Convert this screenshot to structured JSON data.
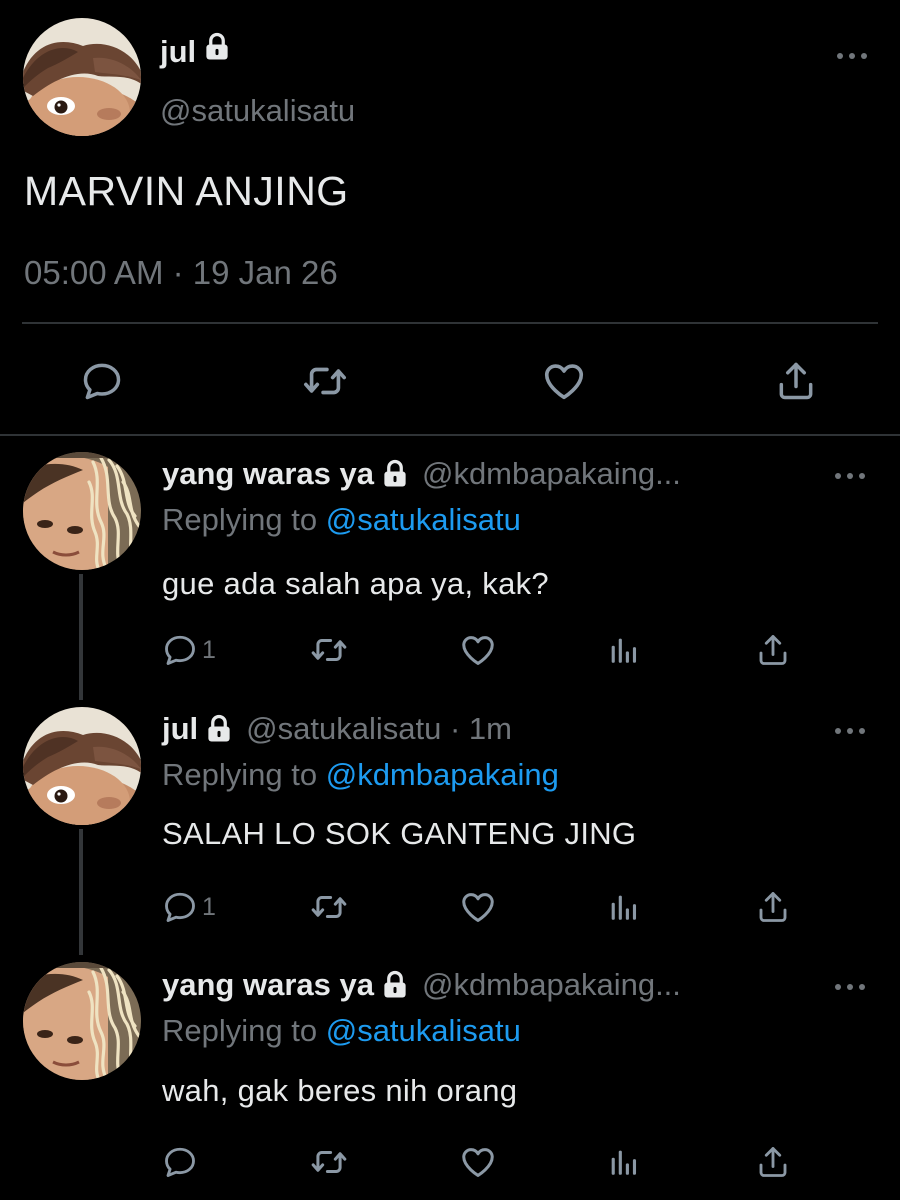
{
  "tweet": {
    "name": "jul",
    "handle": "@satukalisatu",
    "text": "MARVIN ANJING",
    "timestamp": "05:00 AM · 19 Jan 26"
  },
  "replies": [
    {
      "name": "yang waras ya",
      "handle": "@kdmbapakaing...",
      "replying_label": "Replying to ",
      "replying_to": "@satukalisatu",
      "text": "gue ada salah apa ya, kak?",
      "reply_count": "1"
    },
    {
      "name": "jul",
      "handle": "@satukalisatu · 1m",
      "replying_label": "Replying to ",
      "replying_to": "@kdmbapakaing",
      "text": "SALAH LO SOK GANTENG JING",
      "reply_count": "1"
    },
    {
      "name": "yang waras ya",
      "handle": "@kdmbapakaing...",
      "replying_label": "Replying to ",
      "replying_to": "@satukalisatu",
      "text": "wah, gak beres nih orang",
      "reply_count": ""
    }
  ],
  "colors": {
    "background": "#000000",
    "text": "#e7e9ea",
    "secondary": "#71767b",
    "accent": "#1d9bf0",
    "divider": "#2f3336"
  },
  "icons": [
    "lock-icon",
    "more-icon",
    "reply-icon",
    "retweet-icon",
    "like-icon",
    "share-icon",
    "analytics-icon"
  ]
}
